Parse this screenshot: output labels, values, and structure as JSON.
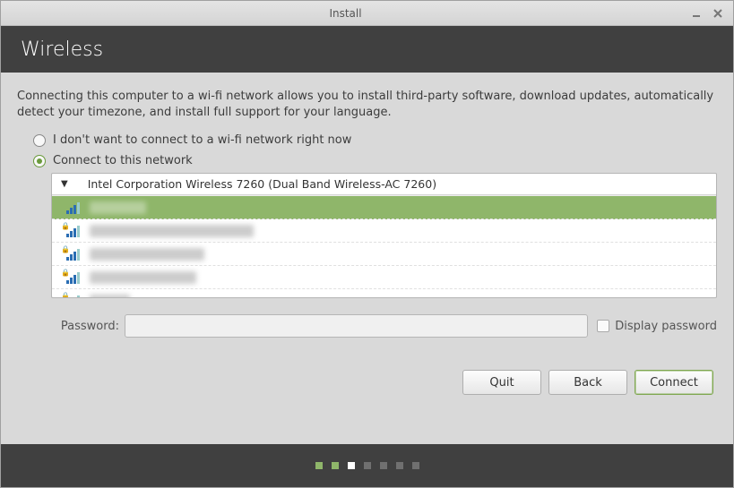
{
  "window": {
    "title": "Install"
  },
  "header": {
    "title": "Wireless"
  },
  "description": "Connecting this computer to a wi-fi network allows you to install third-party software, download updates, automatically detect your timezone, and install full support for your language.",
  "options": {
    "no_connect": "I don't want to connect to a wi-fi network right now",
    "connect": "Connect to this network"
  },
  "adapter": "Intel Corporation Wireless 7260 (Dual Band Wireless-AC 7260)",
  "networks": [
    {
      "ssid": "██████",
      "locked": false,
      "selected": true
    },
    {
      "ssid": "███████████████████",
      "locked": true,
      "selected": false
    },
    {
      "ssid": "█████████████",
      "locked": true,
      "selected": false
    },
    {
      "ssid": "████████████",
      "locked": true,
      "selected": false
    },
    {
      "ssid": "████",
      "locked": true,
      "selected": false
    }
  ],
  "password": {
    "label": "Password:",
    "value": "",
    "display_label": "Display password"
  },
  "buttons": {
    "quit": "Quit",
    "back": "Back",
    "connect": "Connect"
  },
  "progress": {
    "total": 7,
    "current": 2
  }
}
